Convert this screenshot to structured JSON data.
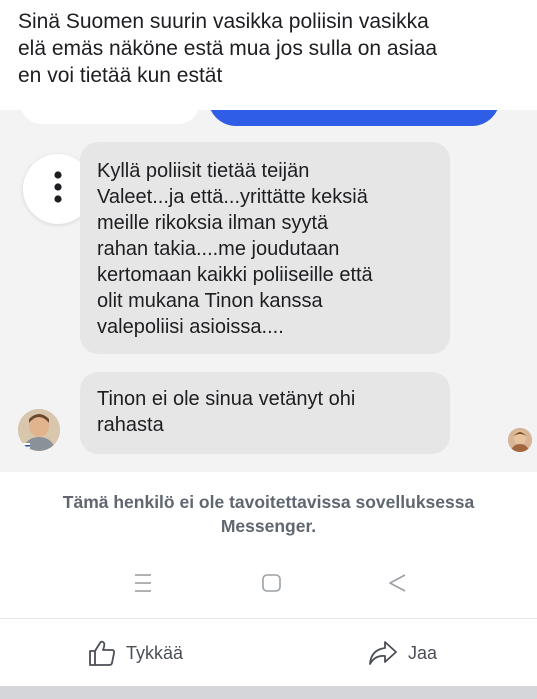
{
  "caption": {
    "lines": [
      "Sinä Suomen suurin vasikka poliisin vasikka",
      "elä emäs näköne estä mua jos sulla on asiaa",
      "en voi tietää kun estät"
    ]
  },
  "chat": {
    "messages": [
      {
        "lines": [
          "Kyllä poliisit tietää teijän",
          "Valeet...ja että...yrittätte keksiä",
          "meille rikoksia ilman syytä",
          "rahan takia....me joudutaan",
          "kertomaan kaikki poliiseille että",
          "olit mukana Tinon kanssa",
          "valepoliisi asioissa...."
        ]
      },
      {
        "lines": [
          "Tinon ei ole sinua vetänyt ohi",
          "rahasta"
        ]
      }
    ]
  },
  "status": {
    "line1": "Tämä henkilö ei ole tavoitettavissa sovelluksessa",
    "line2": "Messenger."
  },
  "actions": {
    "like_label": "Tykkää",
    "share_label": "Jaa"
  },
  "icons": {
    "menu": "more-vertical-icon",
    "like": "thumbs-up-icon",
    "share": "share-arrow-icon",
    "nav_recent": "recent-apps-icon",
    "nav_home": "home-icon",
    "nav_back": "back-icon"
  },
  "colors": {
    "sent_bubble": "#2f5de6",
    "received_bubble": "#e6e6e6",
    "status_text": "#606770"
  }
}
